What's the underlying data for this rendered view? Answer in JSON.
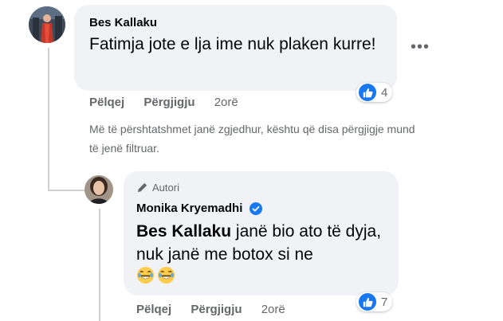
{
  "comment": {
    "author": "Bes Kallaku",
    "text": "Fatimja jote e lja ime nuk plaken kurre!",
    "more_label": "•••",
    "actions": {
      "like": "Pëlqej",
      "reply": "Përgjigju",
      "time": "2orë"
    },
    "reaction_count": "4"
  },
  "notice": "Më të përshtatshmet janë zgjedhur, kështu që disa përgjigje mund të jenë filtruar.",
  "reply": {
    "badge": "Autori",
    "author": "Monika Kryemadhi",
    "mention": "Bes Kallaku",
    "text": " janë bio ato të dyja, nuk janë me botox si ne",
    "actions": {
      "like": "Pëlqej",
      "reply": "Përgjigju",
      "time": "2orë"
    },
    "reaction_count": "7"
  },
  "colors": {
    "bubble": "#f0f2f5",
    "like_blue": "#1877f2",
    "muted": "#65676b",
    "verified": "#1877f2"
  },
  "icons": [
    "like-reaction-icon",
    "verified-badge-icon",
    "pencil-icon",
    "laughing-emoji-icon"
  ]
}
